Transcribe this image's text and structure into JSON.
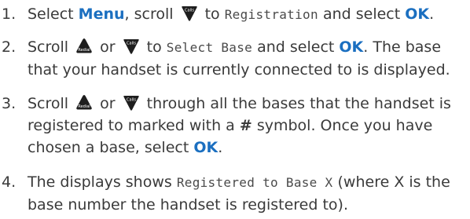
{
  "step1": {
    "number": "1.",
    "t1": "Select ",
    "menu": "Menu",
    "t2": ", scroll ",
    "t3": " to ",
    "lcd_registration": "Registration",
    "t4": " and select ",
    "ok": "OK",
    "t5": "."
  },
  "step2": {
    "number": "2.",
    "t1": "Scroll ",
    "t2": " or ",
    "t3": " to ",
    "lcd_select_base": "Select Base",
    "t4": " and select ",
    "ok": "OK",
    "t5": ". The base that your handset is currently connected to is displayed."
  },
  "step3": {
    "number": "3.",
    "t1": "Scroll ",
    "t2": " or ",
    "t3": " through all the bases that the handset is registered to marked with a ",
    "hash": "#",
    "t4": " symbol. Once you have chosen a base, select ",
    "ok": "OK",
    "t5": "."
  },
  "step4": {
    "number": "4.",
    "t1": "The displays shows ",
    "lcd_registered": "Registered to Base X",
    "t2": " (where X is the base number the handset is registered to)."
  },
  "keys": {
    "up_icon": "redial-up-key-icon",
    "up_caption": "Redial",
    "down_icon": "calls-down-key-icon",
    "down_caption": "Calls"
  },
  "colors": {
    "text": "#3a3a3a",
    "keyword": "#1b6fc0",
    "key_fill": "#1e1e1e"
  }
}
